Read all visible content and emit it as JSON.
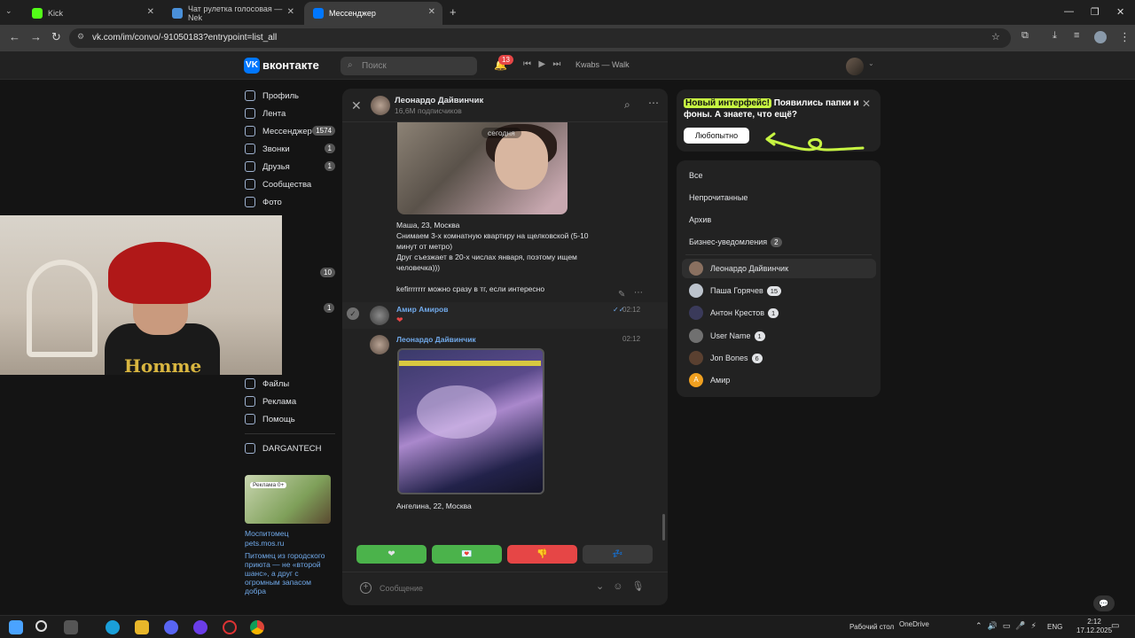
{
  "browser": {
    "tabs": [
      {
        "label": "Kick",
        "color": "#53fc18"
      },
      {
        "label": "Чат рулетка голосовая — Nek",
        "color": "#4a90d9"
      },
      {
        "label": "Мессенджер",
        "color": "#0077ff"
      }
    ],
    "url": "vk.com/im/convo/-91050183?entrypoint=list_all"
  },
  "header": {
    "brand": "вконтакте",
    "logo": "VK",
    "search_placeholder": "Поиск",
    "notifications": "13",
    "track": "Kwabs — Walk"
  },
  "nav": [
    {
      "label": "Профиль",
      "badge": ""
    },
    {
      "label": "Лента",
      "badge": ""
    },
    {
      "label": "Мессенджер",
      "badge": "1574"
    },
    {
      "label": "Звонки",
      "badge": "1"
    },
    {
      "label": "Друзья",
      "badge": "1"
    },
    {
      "label": "Сообщества",
      "badge": ""
    },
    {
      "label": "Фото",
      "badge": ""
    }
  ],
  "nav_hidden_badges": [
    "10",
    "1"
  ],
  "nav_bottom": [
    {
      "label": "Файлы"
    },
    {
      "label": "Реклама"
    },
    {
      "label": "Помощь"
    }
  ],
  "nav_group": "DARGANTECH",
  "ad": {
    "title": "Моспитомец",
    "url": "pets.mos.ru",
    "text": "Питомец из городского приюта — не «второй шанс», а друг с огромным запасом добра",
    "badge": "Реклама 0+"
  },
  "webcam": {
    "shirt_text": "Homme"
  },
  "chat": {
    "name": "Леонардо Дайвинчик",
    "subscribers": "16,6М подписчиков",
    "date_chip": "сегодня",
    "message_lines": [
      "Маша, 23, Москва",
      "Снимаем 3-х комнатную квартиру на щелковской (5-10",
      "минут от метро)",
      "Друг съезжает в 20-х числах января, поэтому ищем",
      "человечка)))",
      "",
      "kefirrrrrrr можно сразу в тг, если интересно"
    ],
    "msg2": {
      "sender": "Амир Амиров",
      "reaction": "❤",
      "time": "02:12"
    },
    "msg3": {
      "sender": "Леонардо Дайвинчик",
      "time": "02:12",
      "caption": "Ангелина, 22, Москва"
    },
    "reactions": [
      {
        "emoji": "❤",
        "color": "#4bb34b"
      },
      {
        "emoji": "💌",
        "color": "#4bb34b"
      },
      {
        "emoji": "👎",
        "color": "#e64646"
      },
      {
        "emoji": "💤",
        "color": "#3a3a3a"
      }
    ],
    "composer_placeholder": "Сообщение"
  },
  "promo": {
    "highlight": "Новый интерфейс!",
    "text": " Появились папки и фоны. А знаете, что ещё?",
    "button": "Любопытно"
  },
  "folders": [
    {
      "label": "Все",
      "badge": ""
    },
    {
      "label": "Непрочитанные",
      "badge": ""
    },
    {
      "label": "Архив",
      "badge": ""
    },
    {
      "label": "Бизнес-уведомления",
      "badge": "2"
    }
  ],
  "contacts": [
    {
      "name": "Леонардо Дайвинчик",
      "badge": "",
      "color": "#8a7060"
    },
    {
      "name": "Паша Горячев",
      "badge": "15",
      "color": "#bcc3cc"
    },
    {
      "name": "Антон Крестов",
      "badge": "1",
      "color": "#3a3a5a"
    },
    {
      "name": "User Name",
      "badge": "1",
      "color": "#707070"
    },
    {
      "name": "Jon Bones",
      "badge": "6",
      "color": "#5a4030"
    },
    {
      "name": "Амир",
      "badge": "",
      "color": "#f0a020",
      "initial": "А"
    }
  ],
  "taskbar": {
    "desktop": "Рабочий стол",
    "onedrive": "OneDrive",
    "lang": "ENG",
    "time": "2:12",
    "date": "17.12.2025"
  }
}
